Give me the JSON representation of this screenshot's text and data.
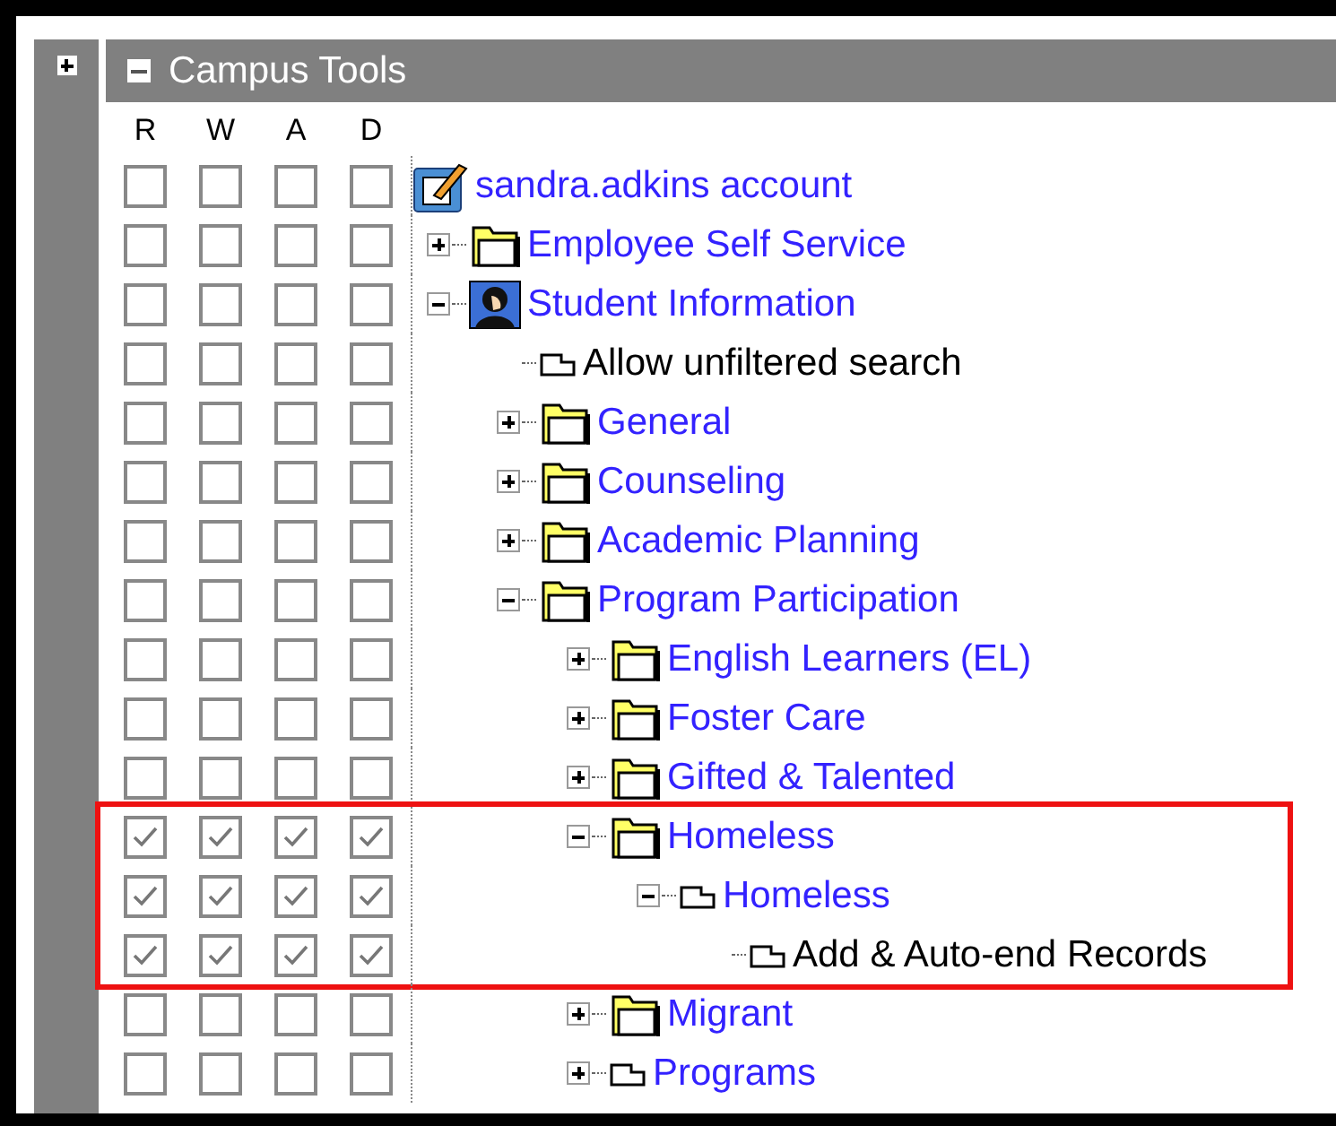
{
  "panel": {
    "title": "Campus Tools",
    "expanded": true
  },
  "columns": [
    "R",
    "W",
    "A",
    "D"
  ],
  "tree": [
    {
      "label": "sandra.adkins account",
      "kind": "account",
      "link": true,
      "perms": [
        false,
        false,
        false,
        false
      ],
      "highlighted": false,
      "children": [
        {
          "label": "Employee Self Service",
          "kind": "folder",
          "link": true,
          "expanded": false,
          "perms": [
            false,
            false,
            false,
            false
          ],
          "highlighted": false
        },
        {
          "label": "Student Information",
          "kind": "person",
          "link": true,
          "expanded": true,
          "perms": [
            false,
            false,
            false,
            false
          ],
          "highlighted": false,
          "children": [
            {
              "label": "Allow unfiltered search",
              "kind": "page",
              "link": false,
              "perms": [
                false,
                false,
                false,
                false
              ],
              "highlighted": false
            },
            {
              "label": "General",
              "kind": "folder",
              "link": true,
              "expanded": false,
              "perms": [
                false,
                false,
                false,
                false
              ],
              "highlighted": false
            },
            {
              "label": "Counseling",
              "kind": "folder",
              "link": true,
              "expanded": false,
              "perms": [
                false,
                false,
                false,
                false
              ],
              "highlighted": false
            },
            {
              "label": "Academic Planning",
              "kind": "folder",
              "link": true,
              "expanded": false,
              "perms": [
                false,
                false,
                false,
                false
              ],
              "highlighted": false
            },
            {
              "label": "Program Participation",
              "kind": "folder",
              "link": true,
              "expanded": true,
              "perms": [
                false,
                false,
                false,
                false
              ],
              "highlighted": false,
              "children": [
                {
                  "label": "English Learners (EL)",
                  "kind": "folder",
                  "link": true,
                  "expanded": false,
                  "perms": [
                    false,
                    false,
                    false,
                    false
                  ],
                  "highlighted": false
                },
                {
                  "label": "Foster Care",
                  "kind": "folder",
                  "link": true,
                  "expanded": false,
                  "perms": [
                    false,
                    false,
                    false,
                    false
                  ],
                  "highlighted": false
                },
                {
                  "label": "Gifted & Talented",
                  "kind": "folder",
                  "link": true,
                  "expanded": false,
                  "perms": [
                    false,
                    false,
                    false,
                    false
                  ],
                  "highlighted": false
                },
                {
                  "label": "Homeless",
                  "kind": "folder",
                  "link": true,
                  "expanded": true,
                  "perms": [
                    true,
                    true,
                    true,
                    true
                  ],
                  "highlighted": true,
                  "children": [
                    {
                      "label": "Homeless",
                      "kind": "page",
                      "link": true,
                      "expanded": true,
                      "perms": [
                        true,
                        true,
                        true,
                        true
                      ],
                      "highlighted": true,
                      "children": [
                        {
                          "label": "Add & Auto-end Records",
                          "kind": "page",
                          "link": false,
                          "perms": [
                            true,
                            true,
                            true,
                            true
                          ],
                          "highlighted": true
                        }
                      ]
                    }
                  ]
                },
                {
                  "label": "Migrant",
                  "kind": "folder",
                  "link": true,
                  "expanded": false,
                  "perms": [
                    false,
                    false,
                    false,
                    false
                  ],
                  "highlighted": false
                },
                {
                  "label": "Programs",
                  "kind": "page",
                  "link": true,
                  "expanded": false,
                  "perms": [
                    false,
                    false,
                    false,
                    false
                  ],
                  "highlighted": false
                }
              ]
            }
          ]
        }
      ]
    }
  ]
}
